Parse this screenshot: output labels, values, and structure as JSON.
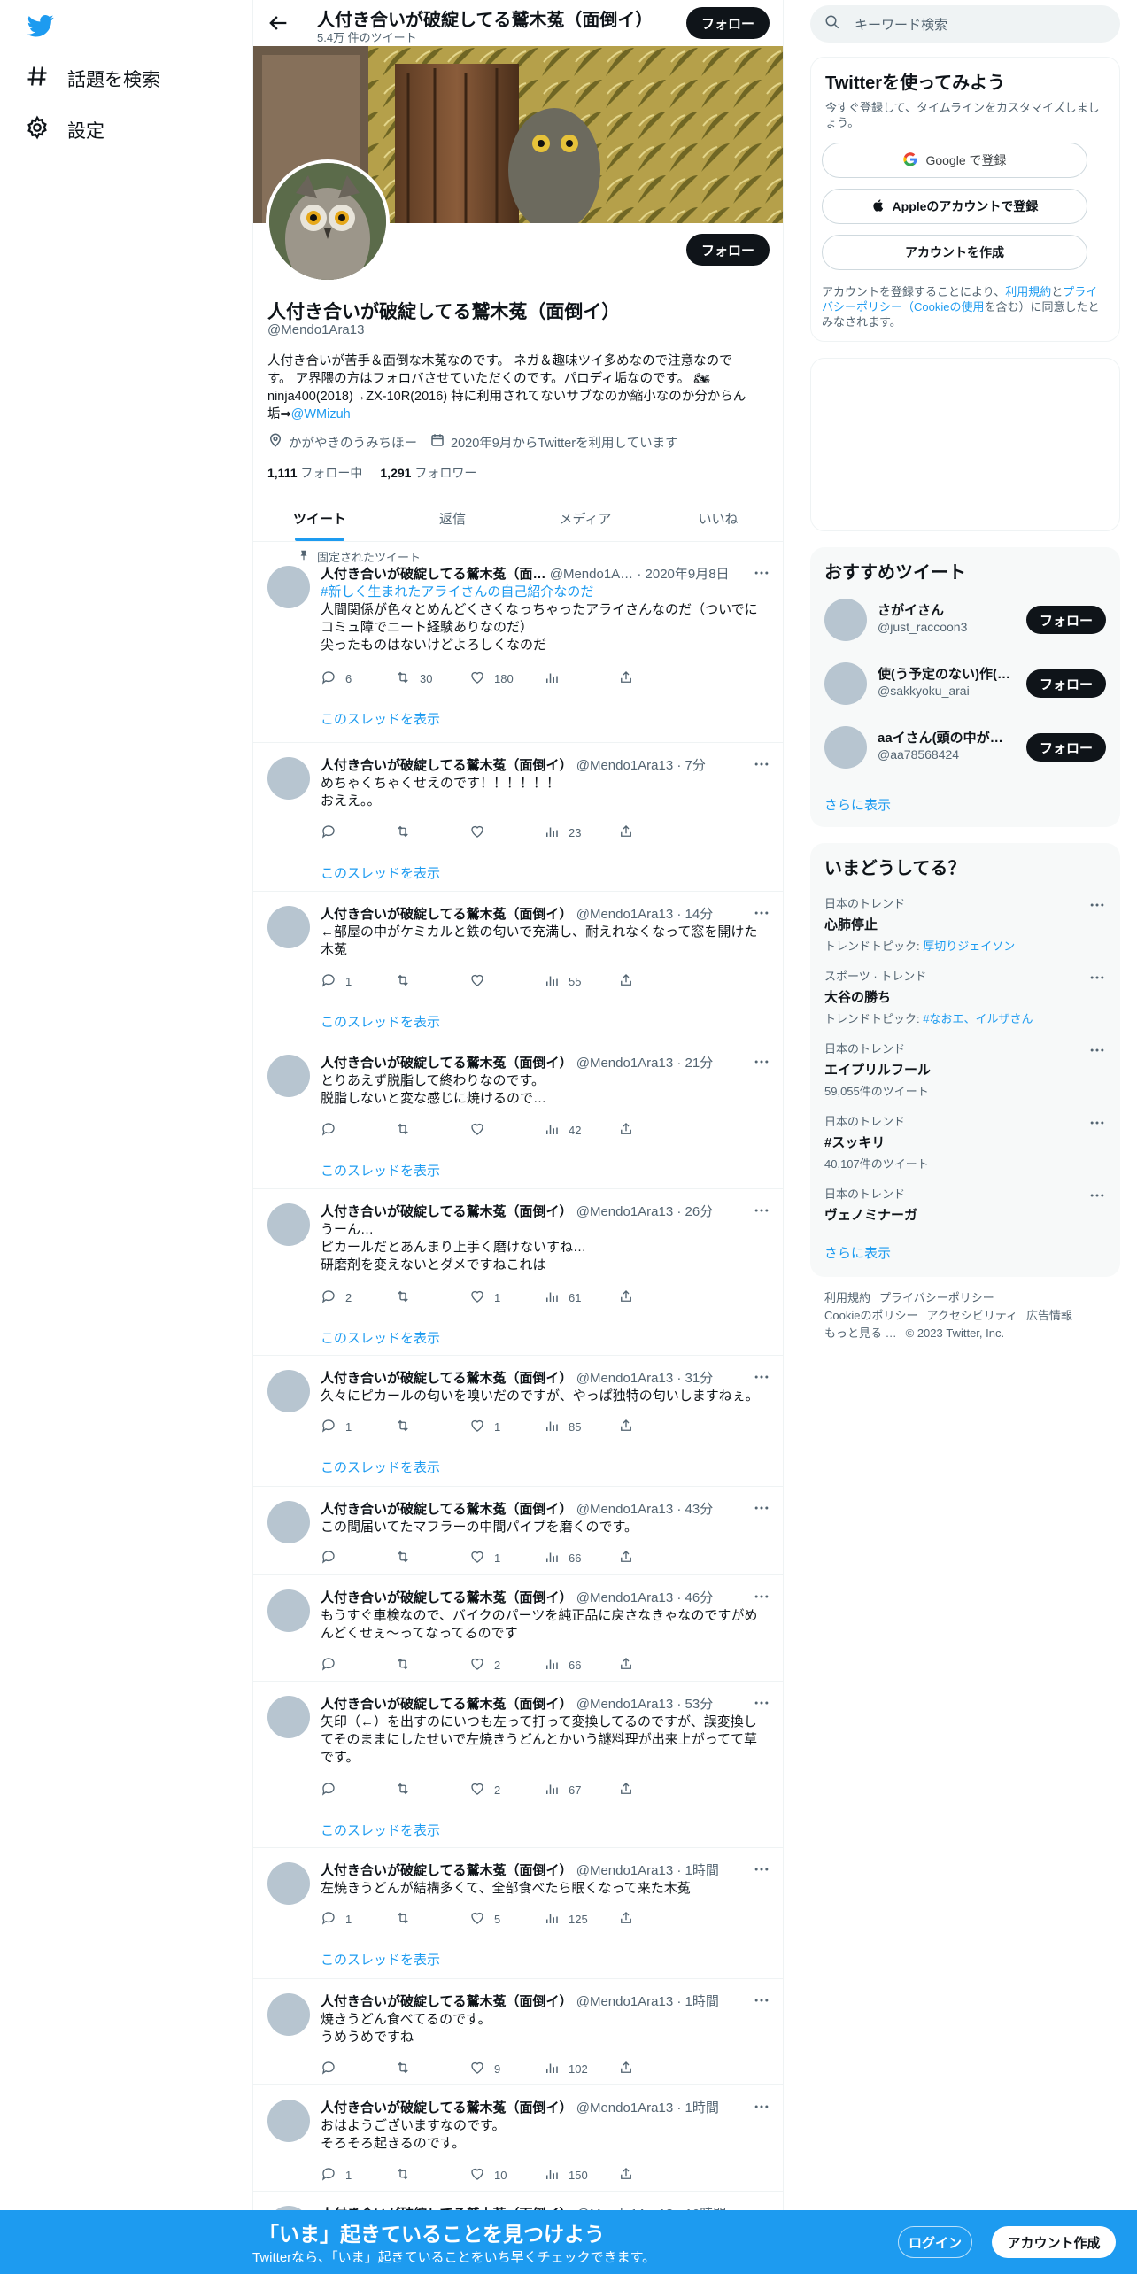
{
  "leftnav": {
    "items": [
      {
        "label": "話題を検索",
        "icon": "hashtag-icon"
      },
      {
        "label": "設定",
        "icon": "gear-icon"
      }
    ]
  },
  "header": {
    "title": "人付き合いが破綻してる鷲木菟（面倒イ）",
    "subtitle": "5.4万 件のツイート",
    "follow_label": "フォロー"
  },
  "profile": {
    "name": "人付き合いが破綻してる鷲木菟（面倒イ）",
    "handle": "@Mendo1Ara13",
    "follow_label": "フォロー",
    "bio_line1": "人付き合いが苦手＆面倒な木菟なのです。 ネガ＆趣味ツイ多めなので注意なので",
    "bio_line2": "す。 ア界隈の方はフォロバさせていただくのです。パロディ垢なのです。 🏍",
    "bio_line3": "ninja400(2018)→ZX-10R(2016) 特に利用されてないサブなのか縮小なのか分からん",
    "bio_line4_prefix": "垢⇒",
    "bio_link": "@WMizuh",
    "location": "かがやきのうみちほー",
    "joined": "2020年9月からTwitterを利用しています",
    "following_count": "1,111",
    "following_label": "フォロー中",
    "followers_count": "1,291",
    "followers_label": "フォロワー"
  },
  "tabs": [
    "ツイート",
    "返信",
    "メディア",
    "いいね"
  ],
  "pinned_label": "固定されたツイート",
  "show_thread_label": "このスレッドを表示",
  "tweets": [
    {
      "name": "人付き合いが破綻してる鷲木菟（面…",
      "meta": "@Mendo1A… · 2020年9月8日",
      "hashtag": "#新しく生まれたアライさんの自己紹介なのだ",
      "text": "人間関係が色々とめんどくさくなっちゃったアライさんなのだ（ついでに\nコミュ障でニート経験ありなのだ）\n尖ったものはないけどよろしくなのだ",
      "reply": "6",
      "retweet": "30",
      "like": "180",
      "views": ""
    },
    {
      "name": "人付き合いが破綻してる鷲木菟（面倒イ）",
      "meta": "@Mendo1Ara13 · 7分",
      "text": "めちゃくちゃくせえのです！！！！！！\nおええ。。",
      "reply": "",
      "retweet": "",
      "like": "",
      "views": "23"
    },
    {
      "name": "人付き合いが破綻してる鷲木菟（面倒イ）",
      "meta": "@Mendo1Ara13 · 14分",
      "text": "←部屋の中がケミカルと鉄の匂いで充満し、耐えれなくなって窓を開けた\n木菟",
      "reply": "1",
      "retweet": "",
      "like": "",
      "views": "55"
    },
    {
      "name": "人付き合いが破綻してる鷲木菟（面倒イ）",
      "meta": "@Mendo1Ara13 · 21分",
      "text": "とりあえず脱脂して終わりなのです。\n脱脂しないと変な感じに焼けるので…",
      "reply": "",
      "retweet": "",
      "like": "",
      "views": "42"
    },
    {
      "name": "人付き合いが破綻してる鷲木菟（面倒イ）",
      "meta": "@Mendo1Ara13 · 26分",
      "text": "うーん…\nピカールだとあんまり上手く磨けないすね…\n研磨剤を変えないとダメですねこれは",
      "reply": "2",
      "retweet": "",
      "like": "1",
      "views": "61"
    },
    {
      "name": "人付き合いが破綻してる鷲木菟（面倒イ）",
      "meta": "@Mendo1Ara13 · 31分",
      "text": "久々にピカールの匂いを嗅いだのですが、やっぱ独特の匂いしますねぇ。",
      "reply": "1",
      "retweet": "",
      "like": "1",
      "views": "85"
    },
    {
      "name": "人付き合いが破綻してる鷲木菟（面倒イ）",
      "meta": "@Mendo1Ara13 · 43分",
      "text": "この間届いてたマフラーの中間パイプを磨くのです。",
      "reply": "",
      "retweet": "",
      "like": "1",
      "views": "66"
    },
    {
      "name": "人付き合いが破綻してる鷲木菟（面倒イ）",
      "meta": "@Mendo1Ara13 · 46分",
      "text": "もうすぐ車検なので、バイクのパーツを純正品に戻さなきゃなのですがめ\nんどくせぇ〜ってなってるのです",
      "reply": "",
      "retweet": "",
      "like": "2",
      "views": "66"
    },
    {
      "name": "人付き合いが破綻してる鷲木菟（面倒イ）",
      "meta": "@Mendo1Ara13 · 53分",
      "text": "矢印（←）を出すのにいつも左って打って変換してるのですが、誤変換し\nてそのままにしたせいで左焼きうどんとかいう謎料理が出来上がってて草\nです。",
      "reply": "",
      "retweet": "",
      "like": "2",
      "views": "67"
    },
    {
      "name": "人付き合いが破綻してる鷲木菟（面倒イ）",
      "meta": "@Mendo1Ara13 · 1時間",
      "text": "左焼きうどんが結構多くて、全部食べたら眠くなって来た木菟",
      "reply": "1",
      "retweet": "",
      "like": "5",
      "views": "125"
    },
    {
      "name": "人付き合いが破綻してる鷲木菟（面倒イ）",
      "meta": "@Mendo1Ara13 · 1時間",
      "text": "焼きうどん食べてるのです。\nうめうめですね",
      "reply": "",
      "retweet": "",
      "like": "9",
      "views": "102"
    },
    {
      "name": "人付き合いが破綻してる鷲木菟（面倒イ）",
      "meta": "@Mendo1Ara13 · 1時間",
      "text": "おはようございますなのです。\nそろそろ起きるのです。",
      "reply": "1",
      "retweet": "",
      "like": "10",
      "views": "150"
    },
    {
      "name": "人付き合いが破綻してる鷲木菟（面倒イ）",
      "meta": "@Mendo1Ara13 · 10時間",
      "text": "",
      "reply": "",
      "retweet": "",
      "like": "",
      "views": ""
    }
  ],
  "right": {
    "search_placeholder": "キーワード検索",
    "signup": {
      "title": "Twitterを使ってみよう",
      "subtitle": "今すぐ登録して、タイムラインをカスタマイズしましょう。",
      "google_label": "Google で登録",
      "apple_label": "Appleのアカウントで登録",
      "create_label": "アカウントを作成",
      "fine_prefix": "アカウントを登録することにより、",
      "fine_terms": "利用規約",
      "fine_and": "と",
      "fine_privacy": "プライバシーポリシー（Cookieの使用",
      "fine_suffix": "を含む）に同意したとみなされます。"
    },
    "recommend": {
      "title": "おすすめツイート",
      "follow_label": "フォロー",
      "users": [
        {
          "name": "さがイさん",
          "handle": "@just_raccoon3"
        },
        {
          "name": "使(う予定のない)作(…",
          "handle": "@sakkyoku_arai"
        },
        {
          "name": "aaイさん(頭の中が荒…",
          "handle": "@aa78568424"
        }
      ],
      "show_more": "さらに表示"
    },
    "trends": {
      "title": "いまどうしてる？",
      "items": [
        {
          "category": "日本のトレンド",
          "name": "心肺停止",
          "sub_prefix": "トレンドトピック: ",
          "sub_link": "厚切りジェイソン",
          "count": ""
        },
        {
          "category": "スポーツ · トレンド",
          "name": "大谷の勝ち",
          "sub_prefix": "トレンドトピック: ",
          "sub_link": "#なおエ、イルザさん",
          "count": ""
        },
        {
          "category": "日本のトレンド",
          "name": "エイプリルフール",
          "sub_prefix": "",
          "sub_link": "",
          "count": "59,055件のツイート"
        },
        {
          "category": "日本のトレンド",
          "name": "#スッキリ",
          "sub_prefix": "",
          "sub_link": "",
          "count": "40,107件のツイート"
        },
        {
          "category": "日本のトレンド",
          "name": "ヴェノミナーガ",
          "sub_prefix": "",
          "sub_link": "",
          "count": ""
        }
      ],
      "show_more": "さらに表示"
    },
    "footer": [
      "利用規約",
      "プライバシーポリシー",
      "Cookieのポリシー",
      "アクセシビリティ",
      "広告情報",
      "もっと見る …",
      "© 2023 Twitter, Inc."
    ]
  },
  "bottombar": {
    "title": "「いま」起きていることを見つけよう",
    "subtitle": "Twitterなら、「いま」起きていることをいち早くチェックできます。",
    "login_label": "ログイン",
    "signup_label": "アカウント作成"
  },
  "colors": {
    "accent": "#1d9bf0",
    "dark": "#0f1419",
    "muted": "#536471"
  }
}
